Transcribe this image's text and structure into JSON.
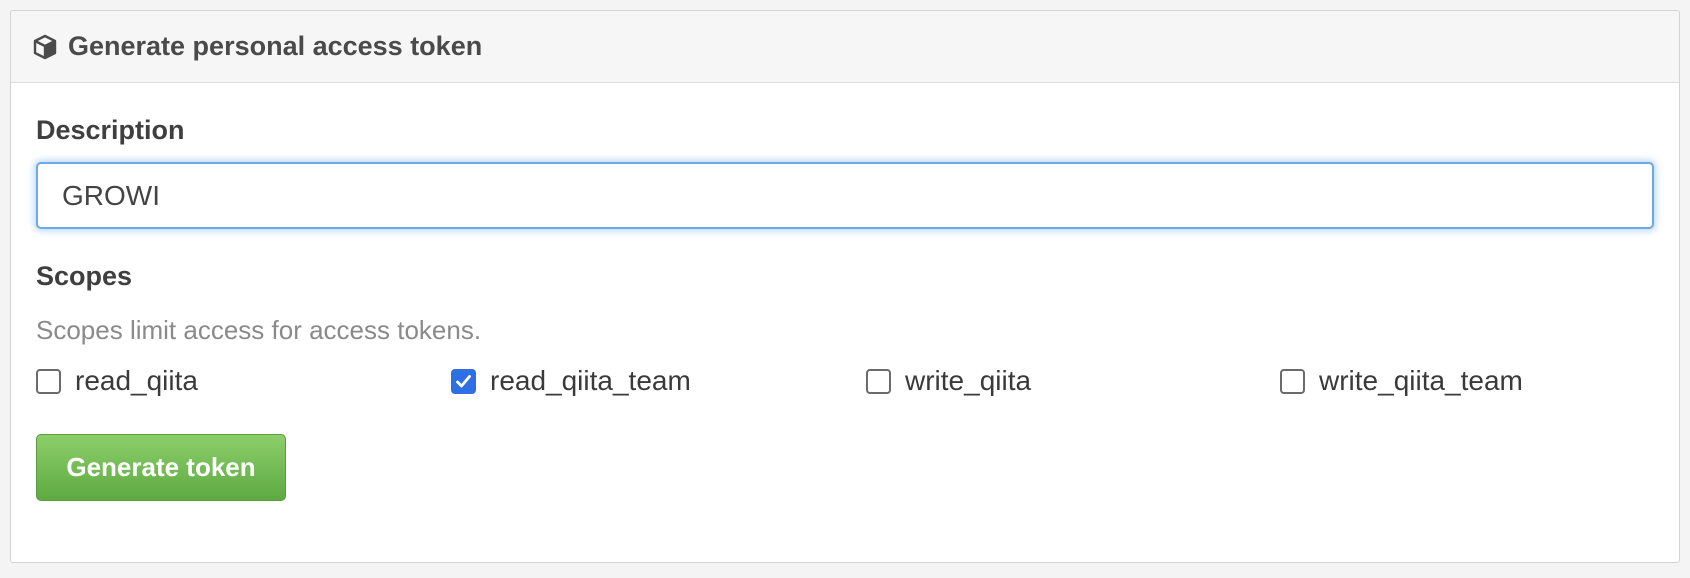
{
  "panel": {
    "title": "Generate personal access token",
    "icon": "cube-icon"
  },
  "description": {
    "label": "Description",
    "value": "GROWI"
  },
  "scopes": {
    "label": "Scopes",
    "help": "Scopes limit access for access tokens.",
    "items": [
      {
        "label": "read_qiita",
        "checked": false
      },
      {
        "label": "read_qiita_team",
        "checked": true
      },
      {
        "label": "write_qiita",
        "checked": false
      },
      {
        "label": "write_qiita_team",
        "checked": false
      }
    ]
  },
  "actions": {
    "generate_label": "Generate token"
  },
  "colors": {
    "accent": "#2e6fe3",
    "button_green": "#6cb74c",
    "focus_border": "#6fa8e6"
  }
}
